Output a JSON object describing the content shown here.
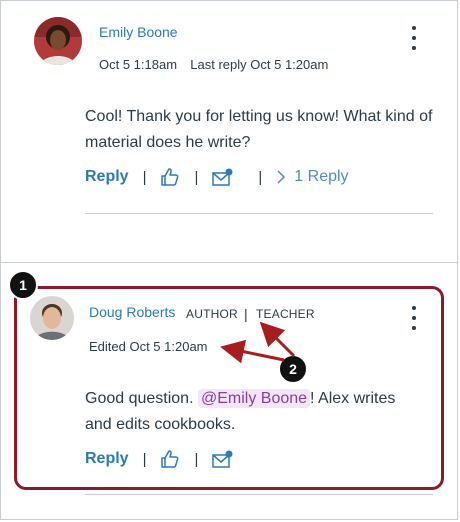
{
  "first_reply": {
    "author": "Emily Boone",
    "date": "Oct 5 1:18am",
    "last_reply": "Last reply Oct 5 1:20am",
    "body": "Cool! Thank you for letting us know! What kind of material does he write?",
    "reply_label": "Reply",
    "replies_label": "1 Reply",
    "separator": "|",
    "menu_icon": "kebab-menu-icon",
    "like_icon": "thumbs-up-icon",
    "unread_icon": "mail-unread-icon",
    "expand_icon": "chevron-right-icon"
  },
  "second_reply": {
    "author": "Doug Roberts",
    "role_author": "AUTHOR",
    "role_sep": "|",
    "role_teacher": "TEACHER",
    "edited": "Edited Oct 5 1:20am",
    "body_before": "Good question. ",
    "mention": "@Emily Boone",
    "body_after": "! Alex writes and edits cookbooks.",
    "reply_label": "Reply",
    "separator": "|",
    "menu_icon": "kebab-menu-icon",
    "like_icon": "thumbs-up-icon",
    "unread_icon": "mail-unread-icon"
  },
  "callouts": {
    "one": "1",
    "two": "2"
  },
  "colors": {
    "link": "#2b7abc",
    "text": "#2d3b45",
    "highlight": "#8b1a2b",
    "mention_bg": "#f2e6f7",
    "mention_text": "#8b3bb0"
  }
}
